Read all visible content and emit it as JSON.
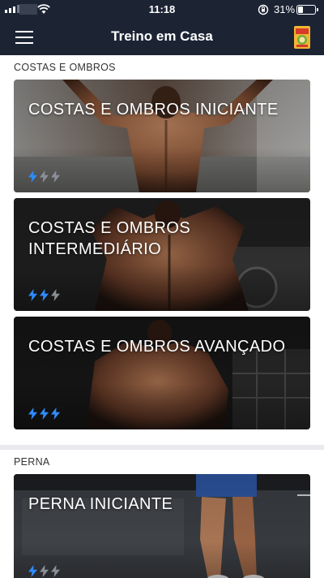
{
  "status_bar": {
    "time": "11:18",
    "battery_text": "31%",
    "battery_level": 0.31
  },
  "nav": {
    "title": "Treino em Casa"
  },
  "colors": {
    "header_bg": "#1c2434",
    "bolt_active": "#2f8cff",
    "bolt_inactive": "#8a8f97"
  },
  "sections": [
    {
      "title": "COSTAS E OMBROS",
      "workouts": [
        {
          "title": "COSTAS E OMBROS INICIANTE",
          "level": 1,
          "max_level": 3
        },
        {
          "title": "COSTAS E OMBROS INTERMEDIÁRIO",
          "level": 2,
          "max_level": 3
        },
        {
          "title": "COSTAS E OMBROS AVANÇADO",
          "level": 3,
          "max_level": 3
        }
      ]
    },
    {
      "title": "PERNA",
      "workouts": [
        {
          "title": "PERNA INICIANTE",
          "level": 1,
          "max_level": 3
        }
      ]
    }
  ]
}
